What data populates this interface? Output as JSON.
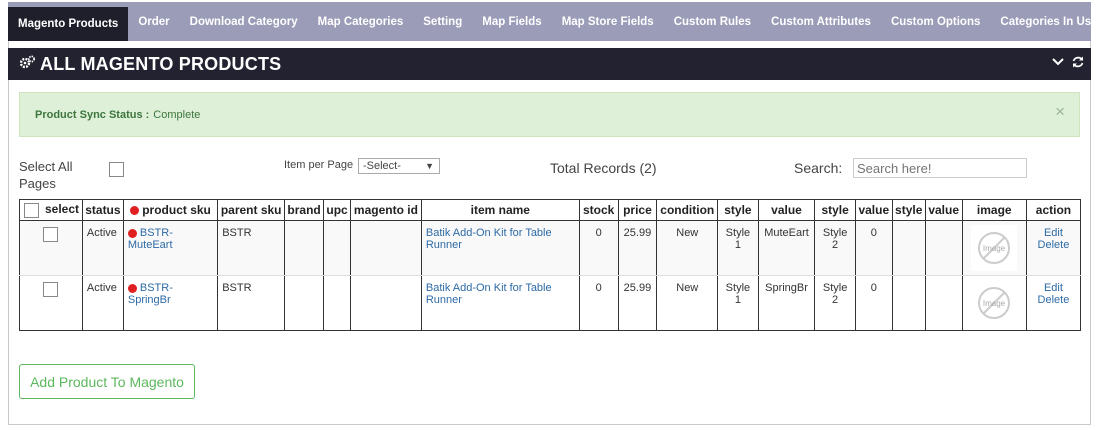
{
  "tabs": [
    {
      "label": "Magento Products",
      "active": true
    },
    {
      "label": "Order"
    },
    {
      "label": "Download Category"
    },
    {
      "label": "Map Categories"
    },
    {
      "label": "Setting"
    },
    {
      "label": "Map Fields"
    },
    {
      "label": "Map Store Fields"
    },
    {
      "label": "Custom Rules"
    },
    {
      "label": "Custom Attributes"
    },
    {
      "label": "Custom Options"
    },
    {
      "label": "Categories In Use"
    }
  ],
  "header": {
    "title": "ALL MAGENTO PRODUCTS",
    "icon": "gears-icon"
  },
  "alert": {
    "label": "Product Sync Status :",
    "value": "Complete",
    "close": "×"
  },
  "controls": {
    "select_all": "Select All",
    "pages": "Pages",
    "item_per_page": "Item per Page",
    "item_per_page_value": "-Select-",
    "total": "Total Records (2)",
    "search_label": "Search:",
    "search_placeholder": "Search here!"
  },
  "table": {
    "columns": [
      "select",
      "status",
      "product sku",
      "parent sku",
      "brand",
      "upc",
      "magento id",
      "item name",
      "stock",
      "price",
      "condition",
      "style",
      "value",
      "style",
      "value",
      "style",
      "value",
      "image",
      "action"
    ],
    "rows": [
      {
        "status": "Active",
        "sku": "BSTR-MuteEart",
        "parent": "BSTR",
        "brand": "",
        "upc": "",
        "magento_id": "",
        "item": "Batik Add-On Kit for Table Runner",
        "stock": "0",
        "price": "25.99",
        "condition": "New",
        "style1": "Style 1",
        "value1": "MuteEart",
        "style2": "Style 2",
        "value2": "0",
        "style3": "",
        "value3": "",
        "image": "Image",
        "edit": "Edit",
        "delete": "Delete"
      },
      {
        "status": "Active",
        "sku": "BSTR-SpringBr",
        "parent": "BSTR",
        "brand": "",
        "upc": "",
        "magento_id": "",
        "item": "Batik Add-On Kit for Table Runner",
        "stock": "0",
        "price": "25.99",
        "condition": "New",
        "style1": "Style 1",
        "value1": "SpringBr",
        "style2": "Style 2",
        "value2": "0",
        "style3": "",
        "value3": "",
        "image": "Image",
        "edit": "Edit",
        "delete": "Delete"
      }
    ]
  },
  "add_button": "Add Product To Magento"
}
